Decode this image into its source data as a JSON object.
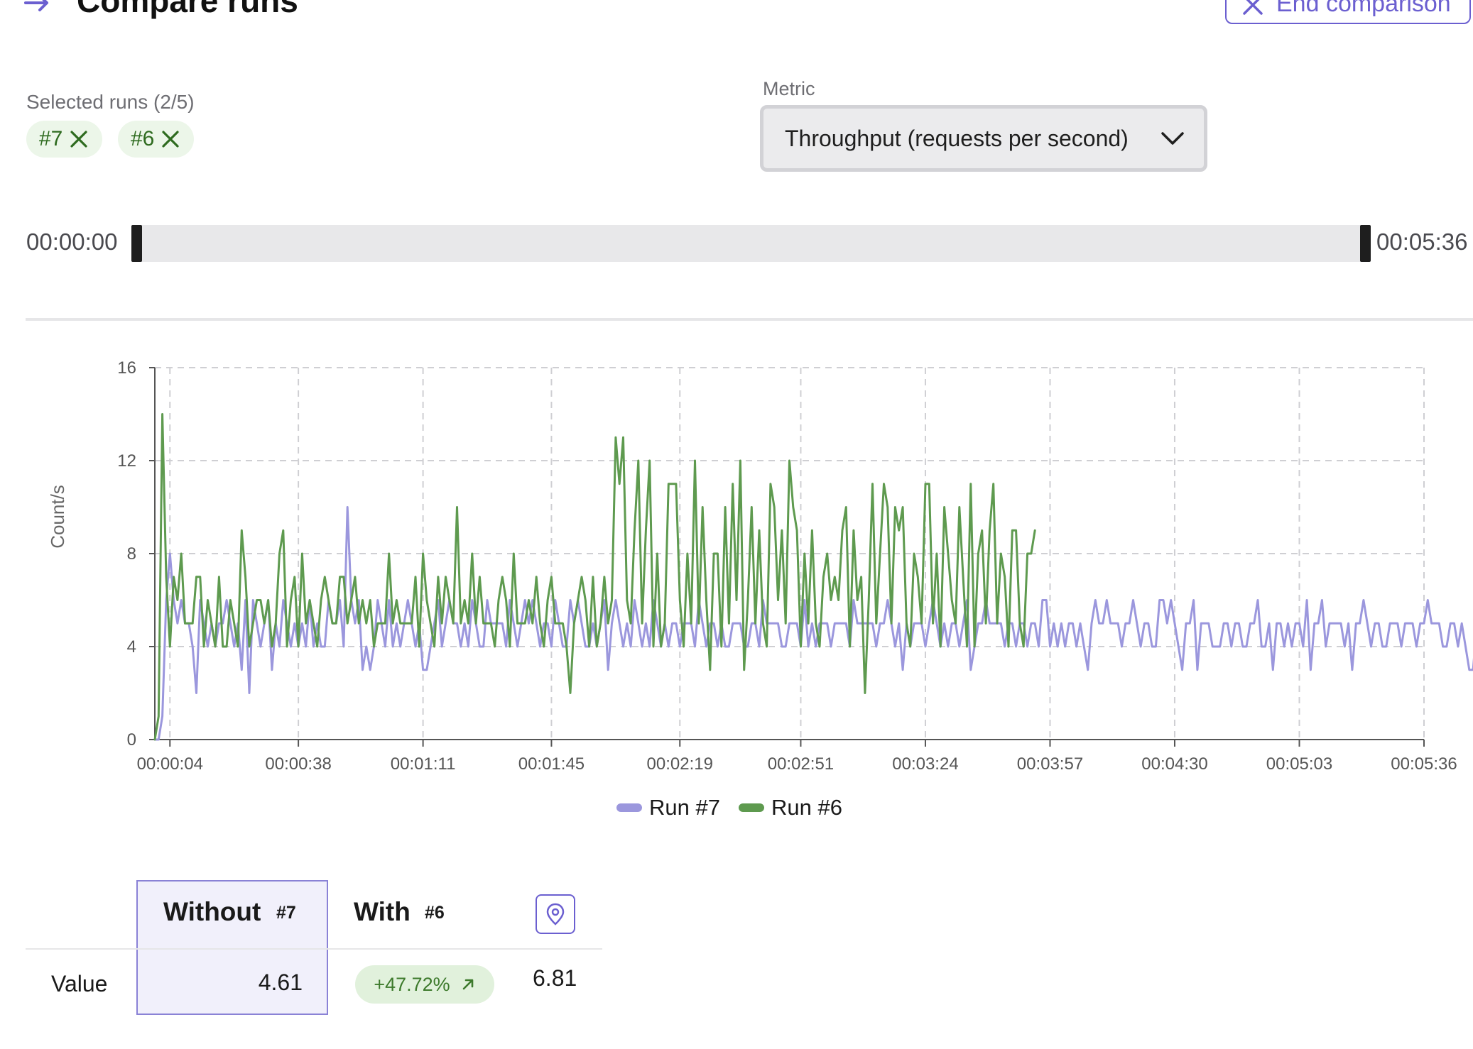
{
  "header": {
    "title": "Compare runs",
    "end_button_label": "End comparison"
  },
  "selected_runs": {
    "label": "Selected runs (2/5)",
    "chips": [
      "#7",
      "#6"
    ]
  },
  "metric": {
    "label": "Metric",
    "selected": "Throughput (requests per second)"
  },
  "time_range": {
    "start": "00:00:00",
    "end": "00:05:36"
  },
  "colors": {
    "accent": "#6b5fd0",
    "run7": "#9b97dd",
    "run6": "#5e9a4f",
    "badge_bg": "#e1f1dc",
    "badge_text": "#3d7a2c"
  },
  "legend": {
    "run7_label": "Run #7",
    "run6_label": "Run #6"
  },
  "chart_data": {
    "type": "line",
    "xlabel": "",
    "ylabel": "Count/s",
    "ylim": [
      0,
      16
    ],
    "yticks": [
      0,
      4,
      8,
      12,
      16
    ],
    "xlim": [
      0,
      336
    ],
    "xticks": [
      {
        "v": 4,
        "label": "00:00:04"
      },
      {
        "v": 38,
        "label": "00:00:38"
      },
      {
        "v": 71,
        "label": "00:01:11"
      },
      {
        "v": 105,
        "label": "00:01:45"
      },
      {
        "v": 139,
        "label": "00:02:19"
      },
      {
        "v": 171,
        "label": "00:02:51"
      },
      {
        "v": 204,
        "label": "00:03:24"
      },
      {
        "v": 237,
        "label": "00:03:57"
      },
      {
        "v": 270,
        "label": "00:04:30"
      },
      {
        "v": 303,
        "label": "00:05:03"
      },
      {
        "v": 336,
        "label": "00:05:36"
      }
    ],
    "grid": true,
    "legend_position": "bottom",
    "series": [
      {
        "name": "Run #7",
        "color": "#9b97dd",
        "x_start": 0,
        "x_step": 1,
        "values": [
          0,
          0,
          1,
          6,
          8,
          6,
          5,
          6,
          5,
          5,
          4,
          2,
          6,
          5,
          4,
          5,
          4,
          5,
          5,
          6,
          5,
          4,
          5,
          3,
          6,
          2,
          6,
          5,
          4,
          5,
          6,
          3,
          5,
          4,
          6,
          5,
          4,
          5,
          4,
          5,
          4,
          6,
          4,
          5,
          4,
          4,
          6,
          5,
          5,
          6,
          4,
          10,
          6,
          5,
          6,
          3,
          4,
          3,
          4,
          6,
          5,
          4,
          6,
          4,
          5,
          4,
          5,
          6,
          5,
          4,
          5,
          3,
          3,
          4,
          5,
          6,
          4,
          5,
          6,
          5,
          5,
          4,
          5,
          4,
          6,
          5,
          4,
          4,
          6,
          5,
          5,
          5,
          5,
          4,
          6,
          5,
          4,
          5,
          6,
          5,
          6,
          5,
          4,
          5,
          5,
          4,
          6,
          5,
          4,
          4,
          6,
          5,
          6,
          5,
          4,
          4,
          5,
          4,
          5,
          6,
          3,
          5,
          6,
          5,
          4,
          5,
          4,
          6,
          5,
          4,
          5,
          4,
          6,
          5,
          4,
          5,
          4,
          5,
          5,
          4,
          5,
          5,
          5,
          4,
          6,
          5,
          4,
          5,
          5,
          4,
          5,
          4,
          4,
          5,
          5,
          5,
          4,
          4,
          5,
          5,
          4,
          6,
          5,
          5,
          5,
          5,
          4,
          4,
          5,
          5,
          5,
          4,
          6,
          4,
          5,
          4,
          5,
          5,
          5,
          4,
          5,
          5,
          5,
          5,
          4,
          6,
          5,
          5,
          5,
          5,
          5,
          4,
          5,
          5,
          6,
          5,
          4,
          5,
          3,
          5,
          4,
          5,
          5,
          5,
          4,
          5,
          6,
          5,
          4,
          5,
          4,
          5,
          5,
          4,
          5,
          6,
          3,
          4,
          5,
          5,
          6,
          5,
          5,
          5,
          5,
          4,
          5,
          5,
          4,
          5,
          5,
          4,
          5,
          5,
          4,
          6,
          6,
          4,
          5,
          4,
          5,
          4,
          5,
          5,
          4,
          5,
          4,
          3,
          5,
          6,
          5,
          5,
          6,
          5,
          5,
          5,
          4,
          5,
          5,
          6,
          5,
          4,
          5,
          5,
          4,
          4,
          6,
          6,
          5,
          6,
          5,
          4,
          3,
          5,
          5,
          6,
          3,
          5,
          5,
          5,
          4,
          4,
          4,
          5,
          5,
          4,
          5,
          5,
          4,
          4,
          5,
          5,
          6,
          4,
          4,
          5,
          3,
          5,
          5,
          4,
          5,
          4,
          5,
          5,
          4,
          6,
          3,
          5,
          5,
          6,
          4,
          5,
          5,
          5,
          5,
          4,
          5,
          3,
          5,
          5,
          6,
          5,
          4,
          5,
          5,
          4,
          4,
          5,
          5,
          5,
          4,
          5,
          5,
          5,
          4,
          5,
          5,
          6,
          5,
          5,
          5,
          4,
          4,
          5,
          5,
          4,
          5,
          4,
          3,
          3,
          5,
          5,
          4,
          3,
          5,
          5,
          4,
          5
        ]
      },
      {
        "name": "Run #6",
        "color": "#5e9a4f",
        "x_start": 0,
        "x_step": 1,
        "values": [
          0,
          1,
          14,
          7,
          4,
          7,
          6,
          8,
          5,
          5,
          5,
          7,
          7,
          4,
          6,
          5,
          4,
          7,
          4,
          4,
          6,
          5,
          4,
          9,
          7,
          4,
          5,
          6,
          6,
          5,
          6,
          4,
          5,
          8,
          9,
          4,
          6,
          7,
          4,
          8,
          5,
          6,
          5,
          4,
          6,
          7,
          6,
          5,
          5,
          7,
          7,
          5,
          6,
          7,
          5,
          6,
          5,
          6,
          4,
          5,
          5,
          5,
          8,
          5,
          6,
          5,
          5,
          5,
          5,
          7,
          4,
          8,
          6,
          5,
          4,
          7,
          5,
          7,
          6,
          5,
          10,
          5,
          6,
          5,
          8,
          5,
          7,
          5,
          5,
          5,
          4,
          6,
          7,
          6,
          4,
          8,
          5,
          5,
          5,
          6,
          5,
          7,
          5,
          4,
          6,
          7,
          5,
          5,
          5,
          4,
          2,
          5,
          6,
          7,
          6,
          4,
          7,
          4,
          5,
          7,
          5,
          6,
          13,
          11,
          13,
          6,
          5,
          9,
          12,
          5,
          9,
          12,
          4,
          8,
          4,
          5,
          11,
          11,
          11,
          6,
          4,
          8,
          5,
          12,
          5,
          10,
          6,
          3,
          8,
          8,
          4,
          10,
          5,
          11,
          6,
          12,
          3,
          6,
          10,
          5,
          9,
          5,
          4,
          11,
          10,
          6,
          9,
          5,
          12,
          10,
          9,
          4,
          8,
          5,
          9,
          5,
          4,
          7,
          8,
          6,
          7,
          6,
          9,
          10,
          4,
          9,
          6,
          7,
          2,
          6,
          11,
          5,
          8,
          11,
          10,
          5,
          10,
          9,
          10,
          5,
          4,
          8,
          7,
          5,
          11,
          11,
          5,
          8,
          4,
          10,
          8,
          6,
          5,
          10,
          7,
          4,
          11,
          4,
          8,
          9,
          5,
          9,
          11,
          5,
          8,
          7,
          4,
          9,
          9,
          5,
          4,
          8,
          8,
          9
        ]
      }
    ]
  },
  "comparison": {
    "without_label": "Without",
    "without_run": "#7",
    "with_label": "With",
    "with_run": "#6",
    "row_label": "Value",
    "without_value": "4.61",
    "delta": "+47.72%",
    "with_value": "6.81"
  }
}
